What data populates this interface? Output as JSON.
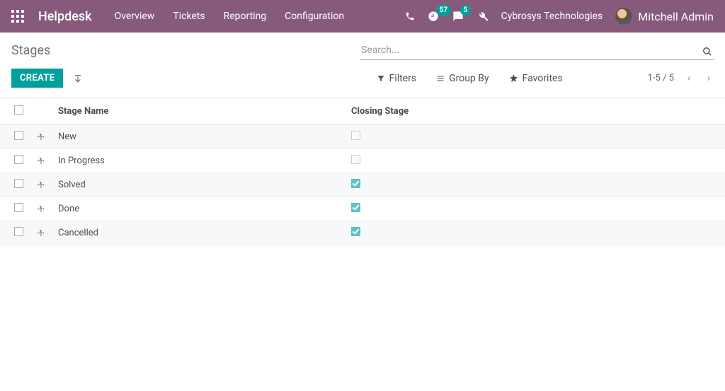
{
  "brand": "Helpdesk",
  "nav": {
    "overview": "Overview",
    "tickets": "Tickets",
    "reporting": "Reporting",
    "configuration": "Configuration"
  },
  "systray": {
    "activities_count": "57",
    "messages_count": "5",
    "company": "Cybrosys Technologies",
    "user": "Mitchell Admin"
  },
  "breadcrumb": "Stages",
  "search": {
    "placeholder": "Search..."
  },
  "buttons": {
    "create": "CREATE"
  },
  "search_options": {
    "filters": "Filters",
    "groupby": "Group By",
    "favorites": "Favorites"
  },
  "pager": {
    "text": "1-5 / 5"
  },
  "columns": {
    "stage_name": "Stage Name",
    "closing_stage": "Closing Stage"
  },
  "rows": [
    {
      "name": "New",
      "closing": false
    },
    {
      "name": "In Progress",
      "closing": false
    },
    {
      "name": "Solved",
      "closing": true
    },
    {
      "name": "Done",
      "closing": true
    },
    {
      "name": "Cancelled",
      "closing": true
    }
  ]
}
